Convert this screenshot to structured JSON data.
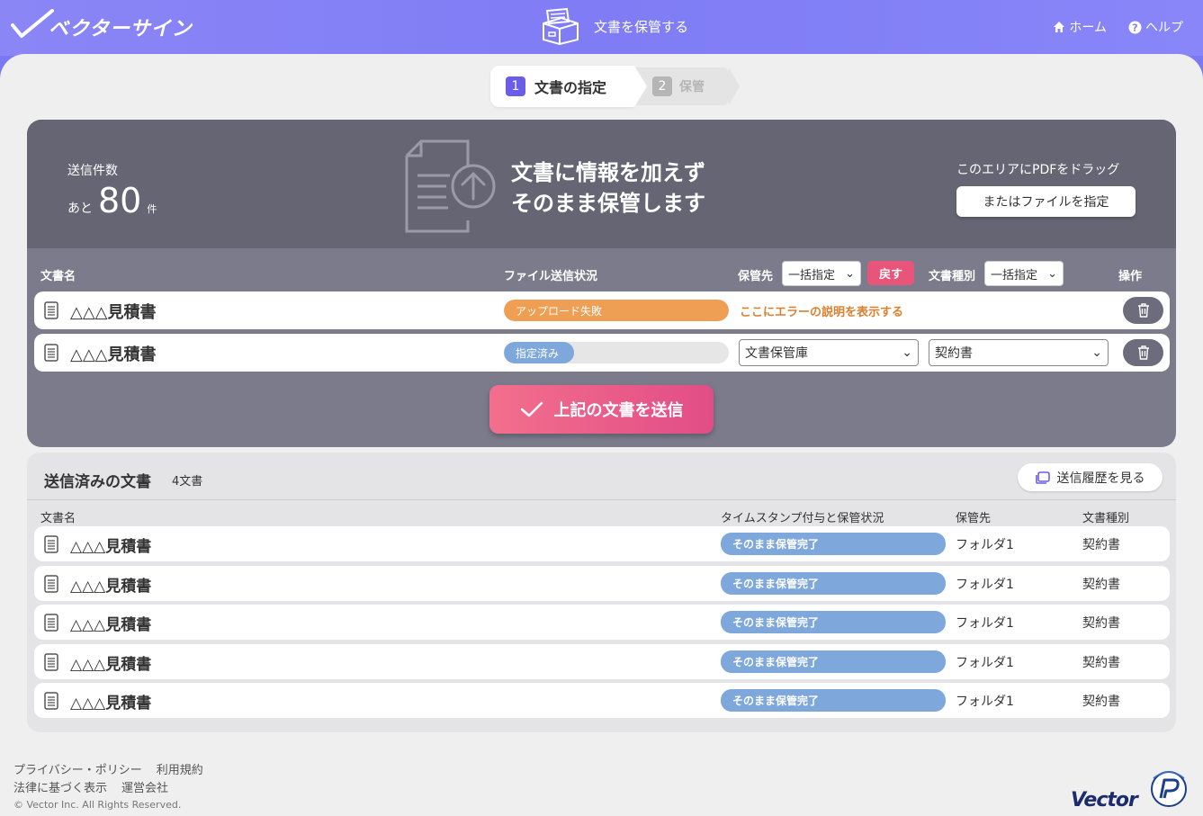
{
  "header": {
    "brand": "ベクターサイン",
    "page_title": "文書を保管する",
    "nav": {
      "home": "ホーム",
      "help": "ヘルプ"
    }
  },
  "steps": [
    {
      "num": "1",
      "label": "文書の指定"
    },
    {
      "num": "2",
      "label": "保管"
    }
  ],
  "upload": {
    "quota_label": "送信件数",
    "quota_prefix": "あと",
    "quota_count": "80",
    "quota_unit": "件",
    "message_line1": "文書に情報を加えず",
    "message_line2": "そのまま保管します",
    "drag_hint": "このエリアにPDFをドラッグ",
    "file_button": "またはファイルを指定"
  },
  "pending_table": {
    "col_name": "文書名",
    "col_status": "ファイル送信状況",
    "col_dest": "保管先",
    "col_type": "文書種別",
    "col_action": "操作",
    "bulk_dest": "一括指定",
    "reset": "戻す",
    "bulk_type": "一括指定",
    "rows": [
      {
        "name": "△△△見積書",
        "status": "アップロード失敗",
        "progress": 1.0,
        "error": "ここにエラーの説明を表示する"
      },
      {
        "name": "△△△見積書",
        "status": "指定済み",
        "progress": 0.31,
        "dest": "文書保管庫",
        "type": "契約書"
      }
    ]
  },
  "submit_label": "上記の文書を送信",
  "sent": {
    "title": "送信済みの文書",
    "count": "4文書",
    "history_button": "送信履歴を見る",
    "col_name": "文書名",
    "col_status": "タイムスタンプ付与と保管状況",
    "col_dest": "保管先",
    "col_type": "文書種別",
    "rows": [
      {
        "name": "△△△見積書",
        "status": "そのまま保管完了",
        "dest": "フォルダ1",
        "type": "契約書"
      },
      {
        "name": "△△△見積書",
        "status": "そのまま保管完了",
        "dest": "フォルダ1",
        "type": "契約書"
      },
      {
        "name": "△△△見積書",
        "status": "そのまま保管完了",
        "dest": "フォルダ1",
        "type": "契約書"
      },
      {
        "name": "△△△見積書",
        "status": "そのまま保管完了",
        "dest": "フォルダ1",
        "type": "契約書"
      },
      {
        "name": "△△△見積書",
        "status": "そのまま保管完了",
        "dest": "フォルダ1",
        "type": "契約書"
      }
    ]
  },
  "footer": {
    "privacy": "プライバシー・ポリシー",
    "terms": "利用規約",
    "legal": "法律に基づく表示",
    "company": "運営会社",
    "copyright": "© Vector Inc. All Rights Reserved.",
    "vector_logo": "Vector"
  },
  "colors": {
    "accent": "#6a5de8",
    "error": "#f0a050",
    "assigned": "#7ea7dc",
    "submit": "#e14d86"
  }
}
